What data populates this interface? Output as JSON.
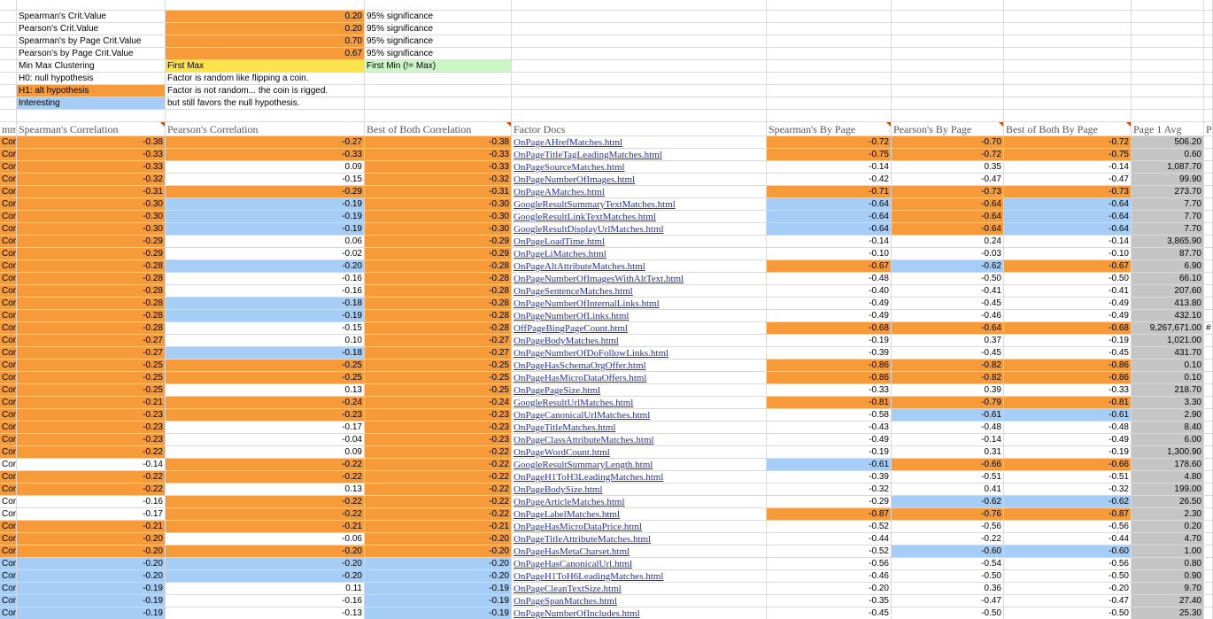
{
  "colors": {
    "orange": "#f79a3a",
    "blue": "#a6cdf5",
    "gray": "#c5c5c5",
    "yellow": "#ffe34d",
    "green": "#cdf5c7",
    "link": "#1f2fb3"
  },
  "legend": [
    {
      "label": "Spearman's Crit.Value",
      "fill": "none",
      "value": "0.20",
      "value_fill": "orange",
      "note": "95% significance",
      "note_fill": "none"
    },
    {
      "label": "Pearson's Crit.Value",
      "fill": "none",
      "value": "0.20",
      "value_fill": "orange",
      "note": "95% significance",
      "note_fill": "none"
    },
    {
      "label": "Spearman's by Page Crit.Value",
      "fill": "none",
      "value": "0.70",
      "value_fill": "orange",
      "note": "95% significance",
      "note_fill": "none"
    },
    {
      "label": "Pearson's by Page Crit.Value",
      "fill": "none",
      "value": "0.67",
      "value_fill": "orange",
      "note": "95% significance",
      "note_fill": "none"
    },
    {
      "label": "Min Max Clustering",
      "fill": "none",
      "value": "First Max",
      "value_fill": "yellow",
      "note": "First Min (!= Max)",
      "note_fill": "green"
    },
    {
      "label": "H0: null hypothesis",
      "fill": "none",
      "value": "Factor is random like flipping a coin.",
      "value_fill": "none",
      "note": "",
      "note_fill": "none"
    },
    {
      "label": "H1: alt hypothesis",
      "fill": "orange",
      "value": "Factor is not random... the coin is rigged.",
      "value_fill": "none",
      "note": "",
      "note_fill": "none"
    },
    {
      "label": "Interesting",
      "fill": "blue",
      "value": "but still favors the null hypothesis.",
      "value_fill": "none",
      "note": "",
      "note_fill": "none"
    }
  ],
  "headers": {
    "col_a": "mm",
    "spearman": "Spearman's Correlation",
    "pearson": "Pearson's Correlation",
    "best_both": "Best of Both Correlation",
    "factor_docs": "Factor Docs",
    "spearman_page": "Spearman's By Page",
    "pearson_page": "Pearson's By Page",
    "best_page": "Best of Both By Page",
    "page1_avg": "Page 1 Avg",
    "col_last": "P"
  },
  "rows": [
    {
      "a": "Corr",
      "s": "-0.38",
      "sf": "orange",
      "p": "-0.27",
      "pf": "orange",
      "b": "-0.38",
      "bf": "orange",
      "doc": "OnPageAHrefMatches.html",
      "sp": "-0.72",
      "spf": "orange",
      "pp": "-0.70",
      "ppf": "orange",
      "bp": "-0.72",
      "bpf": "orange",
      "avg": "506.20",
      "extra": ""
    },
    {
      "a": "Corr",
      "s": "-0.33",
      "sf": "orange",
      "p": "-0.33",
      "pf": "orange",
      "b": "-0.33",
      "bf": "orange",
      "doc": "OnPageTitleTagLeadingMatches.html",
      "sp": "-0.75",
      "spf": "orange",
      "pp": "-0.72",
      "ppf": "orange",
      "bp": "-0.75",
      "bpf": "orange",
      "avg": "0.60",
      "extra": ""
    },
    {
      "a": "Corr",
      "s": "-0.33",
      "sf": "orange",
      "p": "0.09",
      "pf": "none",
      "b": "-0.33",
      "bf": "orange",
      "doc": "OnPageSourceMatches.html",
      "sp": "-0.14",
      "spf": "none",
      "pp": "0.35",
      "ppf": "none",
      "bp": "-0.14",
      "bpf": "none",
      "avg": "1,087.70",
      "extra": ""
    },
    {
      "a": "Corr",
      "s": "-0.32",
      "sf": "orange",
      "p": "-0.15",
      "pf": "none",
      "b": "-0.32",
      "bf": "orange",
      "doc": "OnPageNumberOfImages.html",
      "sp": "-0.42",
      "spf": "none",
      "pp": "-0.47",
      "ppf": "none",
      "bp": "-0.47",
      "bpf": "none",
      "avg": "99.90",
      "extra": ""
    },
    {
      "a": "Corr",
      "s": "-0.31",
      "sf": "orange",
      "p": "-0.29",
      "pf": "orange",
      "b": "-0.31",
      "bf": "orange",
      "doc": "OnPageAMatches.html",
      "sp": "-0.71",
      "spf": "orange",
      "pp": "-0.73",
      "ppf": "orange",
      "bp": "-0.73",
      "bpf": "orange",
      "avg": "273.70",
      "extra": ""
    },
    {
      "a": "Corr",
      "s": "-0.30",
      "sf": "orange",
      "p": "-0.19",
      "pf": "blue",
      "b": "-0.30",
      "bf": "orange",
      "doc": "GoogleResultSummaryTextMatches.html",
      "sp": "-0.64",
      "spf": "blue",
      "pp": "-0.64",
      "ppf": "orange",
      "bp": "-0.64",
      "bpf": "blue",
      "avg": "7.70",
      "extra": ""
    },
    {
      "a": "Corr",
      "s": "-0.30",
      "sf": "orange",
      "p": "-0.19",
      "pf": "blue",
      "b": "-0.30",
      "bf": "orange",
      "doc": "GoogleResultLinkTextMatches.html",
      "sp": "-0.64",
      "spf": "blue",
      "pp": "-0.64",
      "ppf": "orange",
      "bp": "-0.64",
      "bpf": "blue",
      "avg": "7.70",
      "extra": ""
    },
    {
      "a": "Corr",
      "s": "-0.30",
      "sf": "orange",
      "p": "-0.19",
      "pf": "blue",
      "b": "-0.30",
      "bf": "orange",
      "doc": "GoogleResultDisplayUrlMatches.html",
      "sp": "-0.64",
      "spf": "blue",
      "pp": "-0.64",
      "ppf": "orange",
      "bp": "-0.64",
      "bpf": "blue",
      "avg": "7.70",
      "extra": ""
    },
    {
      "a": "Corr",
      "s": "-0.29",
      "sf": "orange",
      "p": "0.06",
      "pf": "none",
      "b": "-0.29",
      "bf": "orange",
      "doc": "OnPageLoadTime.html",
      "sp": "-0.14",
      "spf": "none",
      "pp": "0.24",
      "ppf": "none",
      "bp": "-0.14",
      "bpf": "none",
      "avg": "3,865.90",
      "extra": ""
    },
    {
      "a": "Corr",
      "s": "-0.29",
      "sf": "orange",
      "p": "-0.02",
      "pf": "none",
      "b": "-0.29",
      "bf": "orange",
      "doc": "OnPageLiMatches.html",
      "sp": "-0.10",
      "spf": "none",
      "pp": "-0.03",
      "ppf": "none",
      "bp": "-0.10",
      "bpf": "none",
      "avg": "87.70",
      "extra": ""
    },
    {
      "a": "Corr",
      "s": "-0.28",
      "sf": "orange",
      "p": "-0.20",
      "pf": "blue",
      "b": "-0.28",
      "bf": "orange",
      "doc": "OnPageAltAttributeMatches.html",
      "sp": "-0.67",
      "spf": "orange",
      "pp": "-0.62",
      "ppf": "blue",
      "bp": "-0.67",
      "bpf": "orange",
      "avg": "6.90",
      "extra": ""
    },
    {
      "a": "Corr",
      "s": "-0.28",
      "sf": "orange",
      "p": "-0.16",
      "pf": "none",
      "b": "-0.28",
      "bf": "orange",
      "doc": "OnPageNumberOfImagesWithAltText.html",
      "sp": "-0.48",
      "spf": "none",
      "pp": "-0.50",
      "ppf": "none",
      "bp": "-0.50",
      "bpf": "none",
      "avg": "66.10",
      "extra": ""
    },
    {
      "a": "Corr",
      "s": "-0.28",
      "sf": "orange",
      "p": "-0.16",
      "pf": "none",
      "b": "-0.28",
      "bf": "orange",
      "doc": "OnPageSentenceMatches.html",
      "sp": "-0.40",
      "spf": "none",
      "pp": "-0.41",
      "ppf": "none",
      "bp": "-0.41",
      "bpf": "none",
      "avg": "207.60",
      "extra": ""
    },
    {
      "a": "Corr",
      "s": "-0.28",
      "sf": "orange",
      "p": "-0.18",
      "pf": "blue",
      "b": "-0.28",
      "bf": "orange",
      "doc": "OnPageNumberOfInternalLinks.html",
      "sp": "-0.49",
      "spf": "none",
      "pp": "-0.45",
      "ppf": "none",
      "bp": "-0.49",
      "bpf": "none",
      "avg": "413.80",
      "extra": ""
    },
    {
      "a": "Corr",
      "s": "-0.28",
      "sf": "orange",
      "p": "-0.19",
      "pf": "blue",
      "b": "-0.28",
      "bf": "orange",
      "doc": "OnPageNumberOfLinks.html",
      "sp": "-0.49",
      "spf": "none",
      "pp": "-0.46",
      "ppf": "none",
      "bp": "-0.49",
      "bpf": "none",
      "avg": "432.10",
      "extra": ""
    },
    {
      "a": "Corr",
      "s": "-0.28",
      "sf": "orange",
      "p": "-0.15",
      "pf": "none",
      "b": "-0.28",
      "bf": "orange",
      "doc": "OffPageBingPageCount.html",
      "sp": "-0.68",
      "spf": "orange",
      "pp": "-0.64",
      "ppf": "orange",
      "bp": "-0.68",
      "bpf": "orange",
      "avg": "9,267,671.00",
      "extra": "#"
    },
    {
      "a": "Corr",
      "s": "-0.27",
      "sf": "orange",
      "p": "0.10",
      "pf": "none",
      "b": "-0.27",
      "bf": "orange",
      "doc": "OnPageBodyMatches.html",
      "sp": "-0.19",
      "spf": "none",
      "pp": "0.37",
      "ppf": "none",
      "bp": "-0.19",
      "bpf": "none",
      "avg": "1,021.00",
      "extra": ""
    },
    {
      "a": "Corr",
      "s": "-0.27",
      "sf": "orange",
      "p": "-0.18",
      "pf": "blue",
      "b": "-0.27",
      "bf": "orange",
      "doc": "OnPageNumberOfDoFollowLinks.html",
      "sp": "-0.39",
      "spf": "none",
      "pp": "-0.45",
      "ppf": "none",
      "bp": "-0.45",
      "bpf": "none",
      "avg": "431.70",
      "extra": ""
    },
    {
      "a": "Corr",
      "s": "-0.25",
      "sf": "orange",
      "p": "-0.25",
      "pf": "orange",
      "b": "-0.25",
      "bf": "orange",
      "doc": "OnPageHasSchemaOrgOffer.html",
      "sp": "-0.86",
      "spf": "orange",
      "pp": "-0.82",
      "ppf": "orange",
      "bp": "-0.86",
      "bpf": "orange",
      "avg": "0.10",
      "extra": ""
    },
    {
      "a": "Corr",
      "s": "-0.25",
      "sf": "orange",
      "p": "-0.25",
      "pf": "orange",
      "b": "-0.25",
      "bf": "orange",
      "doc": "OnPageHasMicroDataOffers.html",
      "sp": "-0.86",
      "spf": "orange",
      "pp": "-0.82",
      "ppf": "orange",
      "bp": "-0.86",
      "bpf": "orange",
      "avg": "0.10",
      "extra": ""
    },
    {
      "a": "Corr",
      "s": "-0.25",
      "sf": "orange",
      "p": "0.13",
      "pf": "none",
      "b": "-0.25",
      "bf": "orange",
      "doc": "OnPagePageSize.html",
      "sp": "-0.33",
      "spf": "none",
      "pp": "0.39",
      "ppf": "none",
      "bp": "-0.33",
      "bpf": "none",
      "avg": "218.70",
      "extra": ""
    },
    {
      "a": "Corr",
      "s": "-0.21",
      "sf": "orange",
      "p": "-0.24",
      "pf": "orange",
      "b": "-0.24",
      "bf": "orange",
      "doc": "GoogleResultUrlMatches.html",
      "sp": "-0.81",
      "spf": "orange",
      "pp": "-0.79",
      "ppf": "orange",
      "bp": "-0.81",
      "bpf": "orange",
      "avg": "3.30",
      "extra": ""
    },
    {
      "a": "Corr",
      "s": "-0.23",
      "sf": "orange",
      "p": "-0.23",
      "pf": "orange",
      "b": "-0.23",
      "bf": "orange",
      "doc": "OnPageCanonicalUrlMatches.html",
      "sp": "-0.58",
      "spf": "none",
      "pp": "-0.61",
      "ppf": "blue",
      "bp": "-0.61",
      "bpf": "blue",
      "avg": "2.90",
      "extra": ""
    },
    {
      "a": "Corr",
      "s": "-0.23",
      "sf": "orange",
      "p": "-0.17",
      "pf": "none",
      "b": "-0.23",
      "bf": "orange",
      "doc": "OnPageTitleMatches.html",
      "sp": "-0.43",
      "spf": "none",
      "pp": "-0.48",
      "ppf": "none",
      "bp": "-0.48",
      "bpf": "none",
      "avg": "8.40",
      "extra": ""
    },
    {
      "a": "Corr",
      "s": "-0.23",
      "sf": "orange",
      "p": "-0.04",
      "pf": "none",
      "b": "-0.23",
      "bf": "orange",
      "doc": "OnPageClassAttributeMatches.html",
      "sp": "-0.49",
      "spf": "none",
      "pp": "-0.14",
      "ppf": "none",
      "bp": "-0.49",
      "bpf": "none",
      "avg": "6.00",
      "extra": ""
    },
    {
      "a": "Corr",
      "s": "-0.22",
      "sf": "orange",
      "p": "0.09",
      "pf": "none",
      "b": "-0.22",
      "bf": "orange",
      "doc": "OnPageWordCount.html",
      "sp": "-0.19",
      "spf": "none",
      "pp": "0.31",
      "ppf": "none",
      "bp": "-0.19",
      "bpf": "none",
      "avg": "1,300.90",
      "extra": ""
    },
    {
      "a": "Corr",
      "s": "-0.14",
      "sf": "none",
      "p": "-0.22",
      "pf": "orange",
      "b": "-0.22",
      "bf": "orange",
      "doc": "GoogleResultSummaryLength.html",
      "sp": "-0.61",
      "spf": "blue",
      "pp": "-0.66",
      "ppf": "orange",
      "bp": "-0.66",
      "bpf": "orange",
      "avg": "178.60",
      "extra": ""
    },
    {
      "a": "Corr",
      "s": "-0.22",
      "sf": "orange",
      "p": "-0.22",
      "pf": "orange",
      "b": "-0.22",
      "bf": "orange",
      "doc": "OnPageH1ToH3LeadingMatches.html",
      "sp": "-0.39",
      "spf": "none",
      "pp": "-0.51",
      "ppf": "none",
      "bp": "-0.51",
      "bpf": "none",
      "avg": "4.80",
      "extra": ""
    },
    {
      "a": "Corr",
      "s": "-0.22",
      "sf": "orange",
      "p": "0.13",
      "pf": "none",
      "b": "-0.22",
      "bf": "orange",
      "doc": "OnPageBodySize.html",
      "sp": "-0.32",
      "spf": "none",
      "pp": "0.41",
      "ppf": "none",
      "bp": "-0.32",
      "bpf": "none",
      "avg": "199.00",
      "extra": ""
    },
    {
      "a": "Corr",
      "s": "-0.16",
      "sf": "none",
      "p": "-0.22",
      "pf": "orange",
      "b": "-0.22",
      "bf": "orange",
      "doc": "OnPageArticleMatches.html",
      "sp": "-0.29",
      "spf": "none",
      "pp": "-0.62",
      "ppf": "blue",
      "bp": "-0.62",
      "bpf": "blue",
      "avg": "26.50",
      "extra": ""
    },
    {
      "a": "Corr",
      "s": "-0.17",
      "sf": "none",
      "p": "-0.22",
      "pf": "orange",
      "b": "-0.22",
      "bf": "orange",
      "doc": "OnPageLabelMatches.html",
      "sp": "-0.87",
      "spf": "orange",
      "pp": "-0.76",
      "ppf": "orange",
      "bp": "-0.87",
      "bpf": "orange",
      "avg": "2.30",
      "extra": ""
    },
    {
      "a": "Corr",
      "s": "-0.21",
      "sf": "orange",
      "p": "-0.21",
      "pf": "orange",
      "b": "-0.21",
      "bf": "orange",
      "doc": "OnPageHasMicroDataPrice.html",
      "sp": "-0.52",
      "spf": "none",
      "pp": "-0.56",
      "ppf": "none",
      "bp": "-0.56",
      "bpf": "none",
      "avg": "0.20",
      "extra": ""
    },
    {
      "a": "Corr",
      "s": "-0.20",
      "sf": "orange",
      "p": "-0.06",
      "pf": "none",
      "b": "-0.20",
      "bf": "orange",
      "doc": "OnPageTitleAttributeMatches.html",
      "sp": "-0.44",
      "spf": "none",
      "pp": "-0.22",
      "ppf": "none",
      "bp": "-0.44",
      "bpf": "none",
      "avg": "4.70",
      "extra": ""
    },
    {
      "a": "Corr",
      "s": "-0.20",
      "sf": "orange",
      "p": "-0.20",
      "pf": "orange",
      "b": "-0.20",
      "bf": "orange",
      "doc": "OnPageHasMetaCharset.html",
      "sp": "-0.52",
      "spf": "none",
      "pp": "-0.60",
      "ppf": "blue",
      "bp": "-0.60",
      "bpf": "blue",
      "avg": "1.00",
      "extra": ""
    },
    {
      "a": "Corre",
      "s": "-0.20",
      "sf": "blue",
      "p": "-0.20",
      "pf": "blue",
      "b": "-0.20",
      "bf": "blue",
      "doc": "OnPageHasCanonicalUrl.html",
      "sp": "-0.56",
      "spf": "none",
      "pp": "-0.54",
      "ppf": "none",
      "bp": "-0.56",
      "bpf": "none",
      "avg": "0.80",
      "extra": ""
    },
    {
      "a": "Corre",
      "s": "-0.20",
      "sf": "blue",
      "p": "-0.20",
      "pf": "blue",
      "b": "-0.20",
      "bf": "blue",
      "doc": "OnPageH1ToH6LeadingMatches.html",
      "sp": "-0.46",
      "spf": "none",
      "pp": "-0.50",
      "ppf": "none",
      "bp": "-0.50",
      "bpf": "none",
      "avg": "0.90",
      "extra": ""
    },
    {
      "a": "Corre",
      "s": "-0.19",
      "sf": "blue",
      "p": "0.11",
      "pf": "none",
      "b": "-0.19",
      "bf": "blue",
      "doc": "OnPageCleanTextSize.html",
      "sp": "-0.20",
      "spf": "none",
      "pp": "0.36",
      "ppf": "none",
      "bp": "-0.20",
      "bpf": "none",
      "avg": "9.70",
      "extra": ""
    },
    {
      "a": "Corre",
      "s": "-0.19",
      "sf": "blue",
      "p": "-0.16",
      "pf": "none",
      "b": "-0.19",
      "bf": "blue",
      "doc": "OnPageSpanMatches.html",
      "sp": "-0.35",
      "spf": "none",
      "pp": "-0.47",
      "ppf": "none",
      "bp": "-0.47",
      "bpf": "none",
      "avg": "27.40",
      "extra": ""
    },
    {
      "a": "Corre",
      "s": "-0.19",
      "sf": "blue",
      "p": "-0.13",
      "pf": "none",
      "b": "-0.19",
      "bf": "blue",
      "doc": "OnPageNumberOfIncludes.html",
      "sp": "-0.45",
      "spf": "none",
      "pp": "-0.50",
      "ppf": "none",
      "bp": "-0.50",
      "bpf": "none",
      "avg": "25.30",
      "extra": ""
    }
  ]
}
